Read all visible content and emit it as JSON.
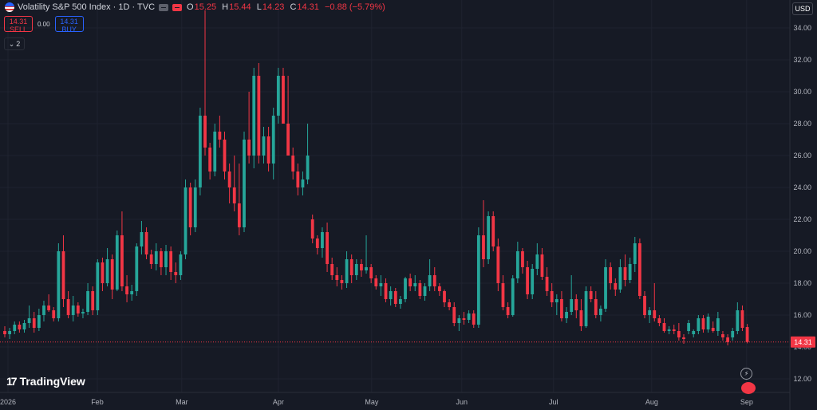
{
  "header": {
    "symbol_title": "Volatility S&P 500 Index · 1D · TVC",
    "open_label": "O",
    "open": "15.25",
    "high_label": "H",
    "high": "15.44",
    "low_label": "L",
    "low": "14.23",
    "close_label": "C",
    "close": "14.31",
    "change": "−0.88 (−5.79%)"
  },
  "trade": {
    "sell_price": "14.31",
    "sell_label": "SELL",
    "spread": "0.00",
    "buy_price": "14.31",
    "buy_label": "BUY"
  },
  "indicators": {
    "count": "2"
  },
  "currency": "USD",
  "logo_text": "TradingView",
  "colors": {
    "up": "#26a69a",
    "down": "#f23645",
    "background": "#161a25",
    "grid": "#1f2330"
  },
  "chart_data": {
    "type": "candlestick",
    "y_axis": {
      "min": 12,
      "max": 35,
      "ticks": [
        12,
        14,
        16,
        18,
        20,
        22,
        24,
        26,
        28,
        30,
        32,
        34
      ],
      "labels": [
        "12.00",
        "14.00",
        "16.00",
        "18.00",
        "20.00",
        "22.00",
        "24.00",
        "26.00",
        "28.00",
        "30.00",
        "32.00",
        "34.00"
      ]
    },
    "x_axis": {
      "labels": [
        "2026",
        "Feb",
        "Mar",
        "Apr",
        "May",
        "Jun",
        "Jul",
        "Aug",
        "Sep"
      ]
    },
    "last_price": 14.31,
    "last_price_label": "14.31",
    "candles": [
      [
        15.0,
        15.3,
        14.6,
        14.8
      ],
      [
        14.8,
        15.2,
        14.5,
        15.0
      ],
      [
        15.0,
        15.6,
        14.8,
        15.4
      ],
      [
        15.4,
        15.6,
        14.9,
        15.1
      ],
      [
        15.1,
        15.7,
        14.9,
        15.5
      ],
      [
        15.5,
        16.6,
        15.2,
        15.8
      ],
      [
        15.8,
        16.2,
        14.9,
        15.2
      ],
      [
        15.2,
        16.4,
        15.0,
        16.0
      ],
      [
        16.0,
        16.9,
        15.6,
        16.6
      ],
      [
        16.6,
        17.3,
        16.2,
        16.3
      ],
      [
        16.3,
        16.5,
        15.6,
        15.8
      ],
      [
        15.8,
        20.5,
        15.6,
        20.0
      ],
      [
        20.0,
        21.0,
        16.5,
        17.0
      ],
      [
        17.0,
        17.5,
        15.8,
        16.0
      ],
      [
        16.0,
        17.2,
        15.6,
        16.6
      ],
      [
        16.6,
        16.8,
        15.9,
        16.1
      ],
      [
        16.1,
        16.4,
        15.8,
        16.2
      ],
      [
        16.2,
        18.0,
        16.0,
        17.5
      ],
      [
        17.5,
        17.8,
        16.0,
        16.3
      ],
      [
        16.3,
        19.5,
        16.0,
        19.3
      ],
      [
        19.3,
        19.6,
        17.5,
        18.0
      ],
      [
        18.0,
        20.2,
        17.8,
        19.5
      ],
      [
        19.5,
        19.8,
        17.0,
        17.6
      ],
      [
        17.6,
        21.3,
        17.5,
        21.0
      ],
      [
        21.0,
        22.5,
        17.5,
        17.8
      ],
      [
        17.8,
        18.5,
        16.8,
        17.3
      ],
      [
        17.3,
        17.9,
        16.9,
        17.5
      ],
      [
        17.5,
        20.5,
        17.2,
        20.3
      ],
      [
        20.3,
        21.9,
        19.8,
        21.2
      ],
      [
        21.2,
        21.5,
        19.5,
        19.8
      ],
      [
        19.8,
        20.1,
        18.9,
        19.2
      ],
      [
        19.2,
        20.5,
        18.8,
        20.0
      ],
      [
        20.0,
        20.2,
        18.5,
        19.0
      ],
      [
        19.0,
        20.4,
        18.5,
        20.0
      ],
      [
        20.0,
        20.3,
        18.2,
        18.7
      ],
      [
        18.7,
        19.3,
        18.0,
        18.5
      ],
      [
        18.5,
        20.0,
        18.2,
        19.8
      ],
      [
        19.8,
        24.5,
        19.5,
        24.0
      ],
      [
        24.0,
        24.3,
        21.0,
        21.5
      ],
      [
        21.5,
        24.5,
        21.2,
        24.0
      ],
      [
        24.0,
        29.0,
        23.5,
        28.5
      ],
      [
        28.5,
        35.1,
        26.0,
        26.5
      ],
      [
        26.5,
        26.8,
        24.5,
        25.0
      ],
      [
        25.0,
        28.0,
        24.7,
        27.5
      ],
      [
        27.5,
        28.5,
        26.5,
        27.0
      ],
      [
        27.0,
        27.5,
        24.5,
        25.0
      ],
      [
        25.0,
        25.5,
        23.0,
        24.0
      ],
      [
        24.0,
        26.0,
        22.5,
        23.0
      ],
      [
        23.0,
        25.5,
        21.0,
        21.5
      ],
      [
        21.5,
        27.5,
        21.2,
        27.0
      ],
      [
        27.0,
        30.0,
        25.5,
        26.0
      ],
      [
        26.0,
        31.5,
        25.2,
        31.0
      ],
      [
        31.0,
        31.8,
        25.5,
        26.0
      ],
      [
        26.0,
        27.8,
        25.5,
        27.2
      ],
      [
        27.2,
        27.8,
        25.0,
        25.5
      ],
      [
        25.5,
        29.0,
        24.5,
        28.5
      ],
      [
        28.5,
        31.5,
        28.0,
        31.0
      ],
      [
        31.0,
        31.5,
        28.0,
        28.0
      ],
      [
        28.0,
        31.0,
        26.0,
        26.0
      ],
      [
        26.0,
        26.5,
        24.5,
        25.0
      ],
      [
        25.0,
        25.5,
        23.5,
        24.0
      ],
      [
        24.0,
        25.0,
        23.5,
        24.5
      ],
      [
        24.5,
        28.0,
        24.2,
        26.0
      ],
      [
        22.0,
        22.3,
        20.5,
        20.8
      ],
      [
        20.8,
        21.0,
        19.8,
        20.2
      ],
      [
        20.2,
        21.5,
        19.6,
        21.2
      ],
      [
        21.2,
        21.8,
        18.7,
        19.2
      ],
      [
        19.2,
        19.6,
        18.2,
        18.5
      ],
      [
        18.5,
        19.0,
        17.8,
        18.2
      ],
      [
        18.2,
        18.5,
        17.6,
        18.0
      ],
      [
        18.0,
        20.0,
        17.7,
        19.5
      ],
      [
        19.5,
        19.8,
        18.0,
        18.5
      ],
      [
        18.5,
        19.5,
        18.2,
        19.2
      ],
      [
        19.2,
        19.5,
        18.4,
        18.8
      ],
      [
        18.8,
        21.0,
        18.6,
        19.0
      ],
      [
        19.0,
        19.2,
        18.0,
        18.3
      ],
      [
        18.3,
        18.5,
        17.6,
        17.8
      ],
      [
        17.8,
        18.5,
        17.2,
        18.0
      ],
      [
        18.0,
        18.3,
        16.8,
        17.0
      ],
      [
        17.0,
        17.8,
        16.6,
        17.5
      ],
      [
        17.5,
        17.7,
        16.5,
        16.7
      ],
      [
        16.7,
        17.2,
        16.4,
        17.0
      ],
      [
        17.0,
        18.4,
        16.8,
        18.3
      ],
      [
        18.3,
        18.6,
        17.5,
        17.8
      ],
      [
        17.8,
        18.5,
        17.5,
        18.0
      ],
      [
        18.0,
        18.2,
        17.0,
        17.2
      ],
      [
        17.2,
        18.0,
        16.9,
        17.8
      ],
      [
        17.8,
        19.5,
        17.5,
        18.5
      ],
      [
        18.5,
        19.0,
        17.5,
        17.8
      ],
      [
        17.8,
        18.0,
        17.2,
        17.5
      ],
      [
        17.5,
        17.6,
        16.5,
        16.8
      ],
      [
        16.8,
        17.0,
        16.3,
        16.5
      ],
      [
        16.5,
        16.8,
        15.3,
        15.5
      ],
      [
        15.5,
        16.0,
        15.0,
        15.8
      ],
      [
        15.8,
        16.2,
        15.4,
        15.7
      ],
      [
        15.7,
        16.3,
        15.5,
        16.1
      ],
      [
        16.1,
        16.3,
        15.2,
        15.4
      ],
      [
        15.4,
        21.5,
        15.2,
        21.0
      ],
      [
        21.0,
        23.2,
        19.0,
        19.5
      ],
      [
        19.5,
        22.5,
        19.2,
        22.2
      ],
      [
        22.2,
        22.5,
        20.0,
        20.3
      ],
      [
        20.3,
        20.8,
        17.5,
        18.0
      ],
      [
        18.0,
        18.5,
        16.3,
        16.5
      ],
      [
        16.5,
        16.8,
        15.8,
        16.0
      ],
      [
        16.0,
        18.5,
        15.9,
        18.3
      ],
      [
        18.3,
        20.6,
        18.0,
        20.0
      ],
      [
        20.0,
        20.2,
        18.6,
        19.0
      ],
      [
        19.0,
        19.4,
        17.0,
        17.3
      ],
      [
        17.3,
        19.2,
        17.0,
        18.9
      ],
      [
        18.9,
        20.5,
        18.5,
        19.8
      ],
      [
        19.8,
        20.2,
        18.2,
        18.4
      ],
      [
        18.4,
        19.0,
        17.2,
        17.5
      ],
      [
        17.5,
        18.0,
        16.5,
        16.8
      ],
      [
        16.8,
        17.3,
        16.0,
        17.0
      ],
      [
        17.0,
        17.5,
        15.6,
        15.8
      ],
      [
        15.8,
        16.5,
        15.5,
        16.2
      ],
      [
        16.2,
        18.5,
        16.0,
        17.0
      ],
      [
        17.0,
        17.3,
        15.8,
        16.3
      ],
      [
        16.3,
        17.0,
        15.0,
        15.3
      ],
      [
        15.3,
        17.8,
        15.2,
        17.5
      ],
      [
        17.5,
        17.8,
        16.8,
        17.0
      ],
      [
        17.0,
        17.5,
        15.8,
        16.0
      ],
      [
        16.0,
        16.6,
        15.6,
        16.4
      ],
      [
        16.4,
        19.5,
        16.2,
        19.0
      ],
      [
        19.0,
        19.3,
        17.6,
        18.0
      ],
      [
        18.0,
        18.3,
        17.2,
        17.6
      ],
      [
        17.6,
        19.5,
        17.4,
        19.0
      ],
      [
        19.0,
        19.8,
        17.8,
        18.2
      ],
      [
        18.2,
        19.6,
        18.0,
        19.2
      ],
      [
        19.2,
        20.9,
        18.7,
        20.5
      ],
      [
        20.5,
        20.8,
        17.0,
        17.2
      ],
      [
        17.2,
        17.5,
        15.8,
        16.0
      ],
      [
        16.0,
        16.5,
        15.5,
        16.3
      ],
      [
        16.3,
        18.0,
        15.6,
        15.8
      ],
      [
        15.8,
        16.0,
        15.3,
        15.5
      ],
      [
        15.5,
        15.8,
        14.9,
        15.0
      ],
      [
        15.0,
        15.3,
        14.8,
        15.1
      ],
      [
        15.1,
        15.4,
        14.8,
        15.0
      ],
      [
        15.0,
        15.5,
        14.4,
        14.6
      ],
      [
        14.6,
        14.8,
        14.2,
        14.5
      ],
      [
        15.0,
        15.7,
        14.8,
        15.5
      ],
      [
        14.8,
        15.1,
        14.6,
        15.0
      ],
      [
        15.0,
        16.0,
        14.8,
        15.8
      ],
      [
        15.8,
        16.0,
        14.9,
        15.1
      ],
      [
        15.1,
        16.1,
        14.9,
        15.9
      ],
      [
        15.2,
        15.6,
        14.9,
        15.0
      ],
      [
        15.0,
        16.2,
        14.7,
        15.8
      ],
      [
        14.8,
        15.0,
        14.4,
        14.6
      ],
      [
        14.6,
        14.8,
        14.1,
        14.3
      ],
      [
        14.6,
        15.2,
        14.4,
        15.0
      ],
      [
        15.0,
        16.8,
        14.8,
        16.3
      ],
      [
        16.3,
        16.6,
        15.0,
        15.2
      ],
      [
        15.25,
        15.44,
        14.23,
        14.31
      ]
    ]
  }
}
